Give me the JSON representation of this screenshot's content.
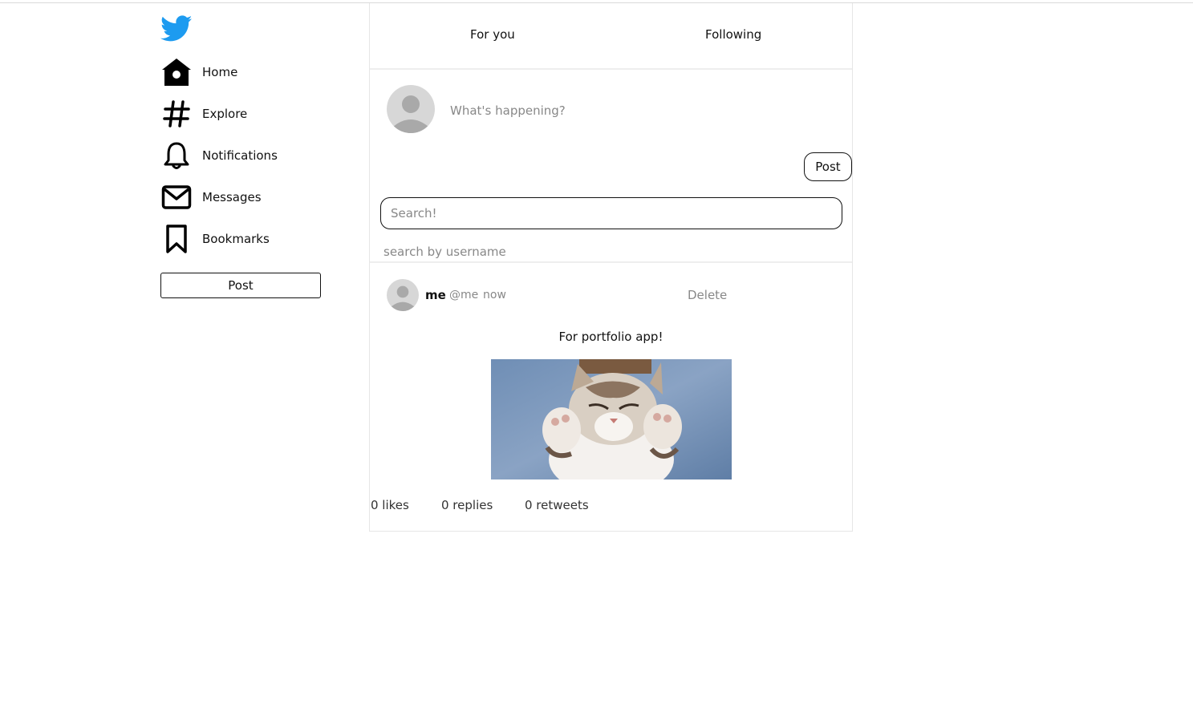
{
  "sidebar": {
    "logo_icon": "twitter-bird-icon",
    "accent_color": "#1d9bf0",
    "items": [
      {
        "label": "Home",
        "icon": "home-icon"
      },
      {
        "label": "Explore",
        "icon": "hashtag-icon"
      },
      {
        "label": "Notifications",
        "icon": "bell-icon"
      },
      {
        "label": "Messages",
        "icon": "envelope-icon"
      },
      {
        "label": "Bookmarks",
        "icon": "bookmark-icon"
      }
    ],
    "post_label": "Post"
  },
  "tabs": [
    {
      "label": "For you"
    },
    {
      "label": "Following"
    }
  ],
  "compose": {
    "placeholder": "What's happening?",
    "post_label": "Post"
  },
  "search": {
    "placeholder": "Search!",
    "hint": "search by username"
  },
  "post": {
    "name": "me",
    "handle": "@me",
    "time": "now",
    "delete_label": "Delete",
    "text": "For portfolio app!",
    "image": "kitten-photo",
    "likes": "0 likes",
    "replies": "0 replies",
    "retweets": "0 retweets"
  }
}
